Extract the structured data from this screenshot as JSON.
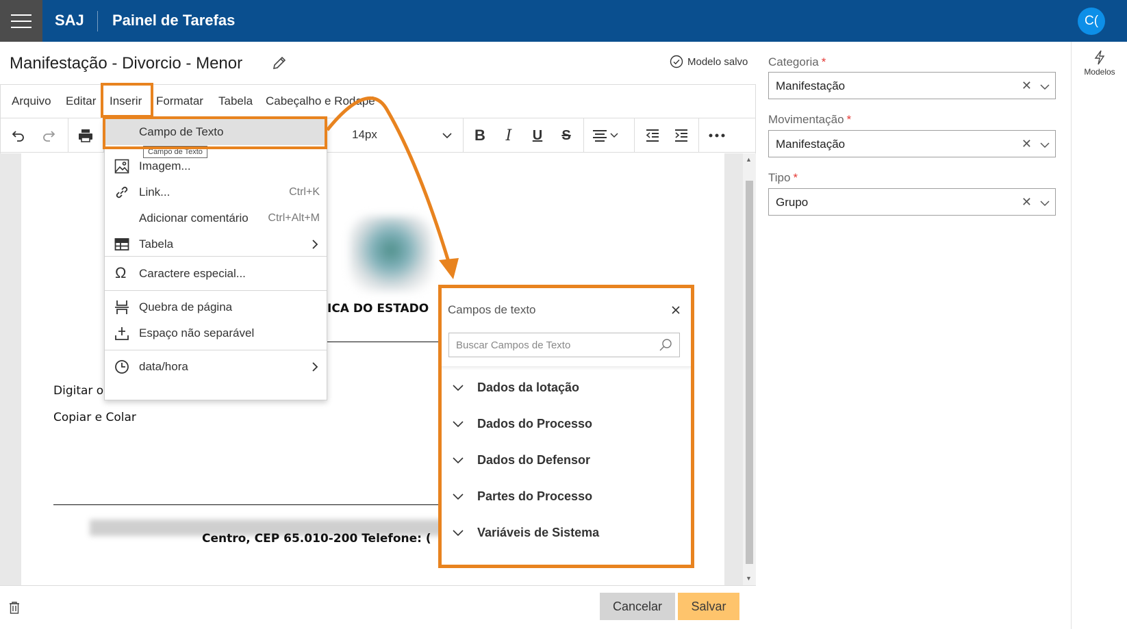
{
  "topbar": {
    "brand": "SAJ",
    "title": "Painel de Tarefas",
    "avatar": "C("
  },
  "header": {
    "doc_title": "Manifestação - Divorcio - Menor",
    "saved_status": "Modelo salvo"
  },
  "menubar": [
    "Arquivo",
    "Editar",
    "Inserir",
    "Formatar",
    "Tabela",
    "Cabeçalho e Rodapé"
  ],
  "toolbar": {
    "font_size": "14px"
  },
  "insert_menu": {
    "items": [
      {
        "label": "Campo de Texto",
        "shortcut": ""
      },
      {
        "label": "Imagem...",
        "shortcut": ""
      },
      {
        "label": "Link...",
        "shortcut": "Ctrl+K"
      },
      {
        "label": "Adicionar comentário",
        "shortcut": "Ctrl+Alt+M"
      },
      {
        "label": "Tabela",
        "shortcut": ""
      },
      {
        "label": "Caractere especial...",
        "shortcut": ""
      },
      {
        "label": "Quebra de página",
        "shortcut": ""
      },
      {
        "label": "Espaço não separável",
        "shortcut": ""
      },
      {
        "label": "data/hora",
        "shortcut": ""
      }
    ],
    "tooltip": "Campo de Texto"
  },
  "document": {
    "heading_fragment": "ICA DO ESTADO",
    "line1": "Digitar o",
    "line2": "Copiar e Colar",
    "footer_line": "Centro, CEP 65.010-200 Telefone: ("
  },
  "campos_panel": {
    "title": "Campos de texto",
    "search_placeholder": "Buscar Campos de Texto",
    "groups": [
      "Dados da lotação",
      "Dados do Processo",
      "Dados do Defensor",
      "Partes do Processo",
      "Variáveis de Sistema"
    ]
  },
  "form": {
    "categoria": {
      "label": "Categoria",
      "value": "Manifestação"
    },
    "movimentacao": {
      "label": "Movimentação",
      "value": "Manifestação"
    },
    "tipo": {
      "label": "Tipo",
      "value": "Grupo"
    }
  },
  "rail": {
    "modelos": "Modelos"
  },
  "footer": {
    "cancel": "Cancelar",
    "save": "Salvar"
  },
  "colors": {
    "topbar": "#0a4f8f",
    "accent_orange": "#e8831f",
    "save_button": "#fec46c",
    "avatar": "#0d8fe8"
  }
}
